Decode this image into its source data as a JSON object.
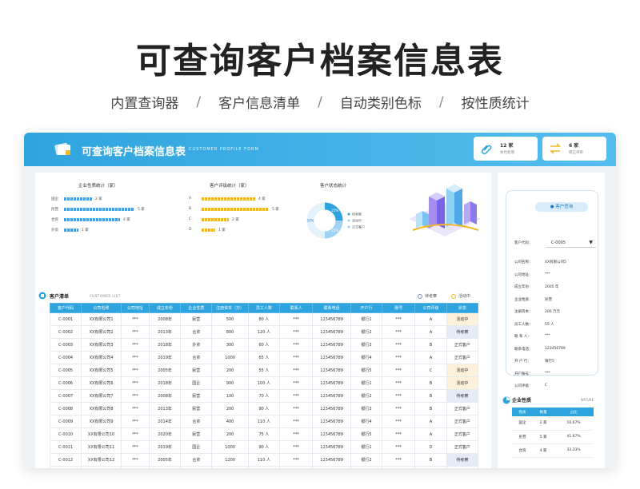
{
  "hero": {
    "title": "可查询客户档案信息表",
    "features": [
      "内置查询器",
      "客户信息清单",
      "自动类别色标",
      "按性质统计"
    ],
    "separator": "/"
  },
  "app": {
    "title": "可查询客户档案信息表",
    "subtitle": "CUSTOMER PROFILE FORM",
    "accent_color": "#2ea4de",
    "cards": [
      {
        "value": "12 家",
        "label": "本月新增",
        "icon": "paperclip-icon"
      },
      {
        "value": "6 家",
        "label": "转正待审",
        "icon": "swap-icon"
      }
    ]
  },
  "charts": {
    "nature": {
      "title": "企业性质统计（家）",
      "rows": [
        {
          "label": "国企",
          "value": 2,
          "text": "2 家"
        },
        {
          "label": "民营",
          "value": 5,
          "text": "5 家"
        },
        {
          "label": "合资",
          "value": 4,
          "text": "4 家"
        },
        {
          "label": "外资",
          "value": 1,
          "text": "1 家"
        }
      ],
      "max": 5,
      "color": "#4a9fe0"
    },
    "rating": {
      "title": "客户评级统计（家）",
      "rows": [
        {
          "label": "A",
          "value": 4,
          "text": "4 家"
        },
        {
          "label": "B",
          "value": 5,
          "text": "5 家"
        },
        {
          "label": "C",
          "value": 2,
          "text": "2 家"
        },
        {
          "label": "D",
          "value": 1,
          "text": "1 家"
        }
      ],
      "max": 5,
      "color": "#f2b728"
    },
    "status": {
      "title": "客户状态统计",
      "center": "50%",
      "segments": [
        {
          "name": "待考察",
          "percent": 25,
          "text": "25%",
          "color": "#2ea4de"
        },
        {
          "name": "活动中",
          "percent": 25,
          "text": "25%",
          "color": "#9fd2f3"
        },
        {
          "name": "正式客户",
          "percent": 50,
          "text": "50%",
          "color": "#e3f1fb"
        }
      ]
    }
  },
  "list": {
    "title": "客户清单",
    "subtitle": "CUSTOMER LIST",
    "legend": [
      {
        "label": "待考察",
        "color": "#7f8fc8"
      },
      {
        "label": "活动中",
        "color": "#f2b728"
      }
    ],
    "columns": [
      "客户代码",
      "公司名称",
      "公司地址",
      "成立年份",
      "企业性质",
      "注册资本（万）",
      "员工人数",
      "联系人",
      "联系电话",
      "开户行",
      "账号",
      "公司评级",
      "状态"
    ],
    "rows": [
      [
        "C-0001",
        "XX有限公司1",
        "***",
        "2008年",
        "民营",
        "500",
        "80 人",
        "***",
        "123456789",
        "银行1",
        "***",
        "A",
        "活动中"
      ],
      [
        "C-0002",
        "XX有限公司2",
        "***",
        "2013年",
        "合资",
        "800",
        "120 人",
        "***",
        "123456789",
        "银行2",
        "***",
        "A",
        "待考察"
      ],
      [
        "C-0003",
        "XX有限公司3",
        "***",
        "2018年",
        "外资",
        "300",
        "60 人",
        "***",
        "123456789",
        "银行3",
        "***",
        "B",
        "正式客户"
      ],
      [
        "C-0004",
        "XX有限公司4",
        "***",
        "2019年",
        "合资",
        "1000",
        "65 人",
        "***",
        "123456789",
        "银行4",
        "***",
        "A",
        "正式客户"
      ],
      [
        "C-0005",
        "XX有限公司5",
        "***",
        "2005年",
        "民营",
        "200",
        "55 人",
        "***",
        "123456789",
        "银行5",
        "***",
        "C",
        "活动中"
      ],
      [
        "C-0006",
        "XX有限公司6",
        "***",
        "2018年",
        "国企",
        "900",
        "100 人",
        "***",
        "123456789",
        "银行1",
        "***",
        "B",
        "活动中"
      ],
      [
        "C-0007",
        "XX有限公司7",
        "***",
        "2008年",
        "民营",
        "100",
        "70 人",
        "***",
        "123456789",
        "银行2",
        "***",
        "B",
        "待考察"
      ],
      [
        "C-0008",
        "XX有限公司8",
        "***",
        "2013年",
        "民营",
        "200",
        "90 人",
        "***",
        "123456789",
        "银行3",
        "***",
        "B",
        "正式客户"
      ],
      [
        "C-0009",
        "XX有限公司9",
        "***",
        "2014年",
        "合资",
        "400",
        "110 人",
        "***",
        "123456789",
        "银行4",
        "***",
        "A",
        "正式客户"
      ],
      [
        "C-0010",
        "XX有限公司10",
        "***",
        "2020年",
        "民营",
        "200",
        "75 人",
        "***",
        "123456789",
        "银行5",
        "***",
        "A",
        "正式客户"
      ],
      [
        "C-0011",
        "XX有限公司11",
        "***",
        "2019年",
        "国企",
        "1000",
        "90 人",
        "***",
        "123456789",
        "银行1",
        "***",
        "D",
        "正式客户"
      ],
      [
        "C-0012",
        "XX有限公司12",
        "***",
        "2005年",
        "合资",
        "1200",
        "110 人",
        "***",
        "123456789",
        "银行2",
        "***",
        "B",
        "待考察"
      ]
    ]
  },
  "query": {
    "title": "客户查询",
    "code_label": "客户代码：",
    "code_value": "C-0005",
    "fields": [
      {
        "k": "公司名称：",
        "v": "XX有限公司5"
      },
      {
        "k": "公司地址：",
        "v": "***"
      },
      {
        "k": "成立年份：",
        "v": "2005 年"
      },
      {
        "k": "企业性质：",
        "v": "民营"
      },
      {
        "k": "注册资本：",
        "v": "200 万元"
      },
      {
        "k": "员工人数：",
        "v": "55 人"
      },
      {
        "k": "联 系 人：",
        "v": "***"
      },
      {
        "k": "联系电话：",
        "v": "123456789"
      },
      {
        "k": "开 户 行：",
        "v": "银行5"
      },
      {
        "k": "开户账号：",
        "v": "***"
      },
      {
        "k": "公司评级：",
        "v": "C"
      }
    ]
  },
  "nature_table": {
    "title": "企业性质",
    "subtitle": "NATURE",
    "columns": [
      "性质",
      "数量",
      "占比"
    ],
    "rows": [
      [
        "国企",
        "2 家",
        "16.67%"
      ],
      [
        "民营",
        "5 家",
        "41.67%"
      ],
      [
        "合资",
        "4 家",
        "33.33%"
      ]
    ]
  }
}
